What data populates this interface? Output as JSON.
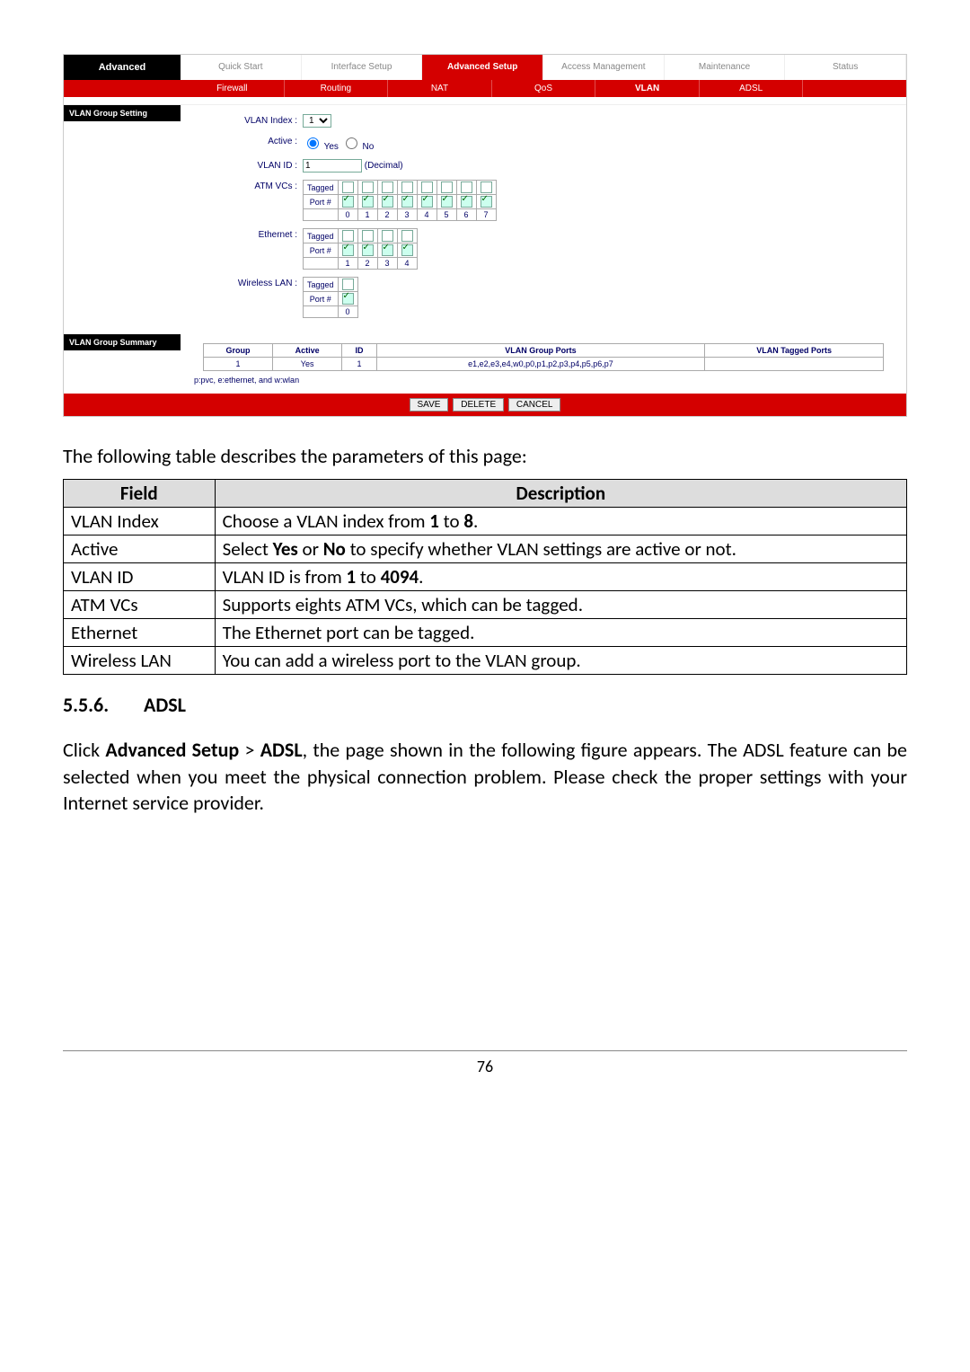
{
  "router": {
    "sideLabel": "Advanced",
    "tabs": [
      "Quick\nStart",
      "Interface\nSetup",
      "Advanced\nSetup",
      "Access\nManagement",
      "Maintenance",
      "Status"
    ],
    "activeTab": 2,
    "subtabs": [
      "Firewall",
      "Routing",
      "NAT",
      "QoS",
      "VLAN",
      "ADSL"
    ],
    "activeSubtab": 4,
    "section1": "VLAN Group Setting",
    "vlanIndexLabel": "VLAN Index :",
    "vlanIndexValue": "1",
    "activeLabel": "Active :",
    "yesLabel": "Yes",
    "noLabel": "No",
    "vlanIdLabel": "VLAN ID :",
    "vlanIdValue": "1",
    "decimal": "(Decimal)",
    "atmLabel": "ATM VCs :",
    "taggedLabel": "Tagged",
    "portLabel": "Port #",
    "atmPorts": [
      "0",
      "1",
      "2",
      "3",
      "4",
      "5",
      "6",
      "7"
    ],
    "ethLabel": "Ethernet :",
    "ethPorts": [
      "1",
      "2",
      "3",
      "4"
    ],
    "wlanLabel": "Wireless LAN :",
    "wlanPorts": [
      "0"
    ],
    "section2": "VLAN Group Summary",
    "summaryHeaders": [
      "Group",
      "Active",
      "ID",
      "VLAN Group Ports",
      "VLAN Tagged Ports"
    ],
    "summaryRow": [
      "1",
      "Yes",
      "1",
      "e1,e2,e3,e4,w0,p0,p1,p2,p3,p4,p5,p6,p7",
      ""
    ],
    "legend": "p:pvc, e:ethernet, and w:wlan",
    "buttons": [
      "SAVE",
      "DELETE",
      "CANCEL"
    ]
  },
  "doc": {
    "intro": "The following table describes the parameters of this page:",
    "colField": "Field",
    "colDesc": "Description",
    "rows": [
      {
        "field": "VLAN Index",
        "desc_pre": "Choose a VLAN index from ",
        "b1": "1",
        "mid": " to ",
        "b2": "8",
        "post": "."
      },
      {
        "field": "Active",
        "desc_pre": "Select ",
        "b1": "Yes",
        "mid": " or ",
        "b2": "No",
        "post": " to specify whether VLAN settings are active or not."
      },
      {
        "field": "VLAN ID",
        "desc_pre": "VLAN ID is from ",
        "b1": "1",
        "mid": " to ",
        "b2": "4094",
        "post": "."
      },
      {
        "field": "ATM VCs",
        "desc_pre": "Supports eights ATM VCs, which can be tagged.",
        "b1": "",
        "mid": "",
        "b2": "",
        "post": ""
      },
      {
        "field": "Ethernet",
        "desc_pre": "The Ethernet port can be tagged.",
        "b1": "",
        "mid": "",
        "b2": "",
        "post": ""
      },
      {
        "field": "Wireless LAN",
        "desc_pre": "You can add a wireless port to the VLAN group.",
        "b1": "",
        "mid": "",
        "b2": "",
        "post": ""
      }
    ],
    "headingNum": "5.5.6.",
    "headingTitle": "ADSL",
    "body_pre": "Click ",
    "body_b1": "Advanced Setup",
    "body_mid1": " > ",
    "body_b2": "ADSL",
    "body_post": ", the page shown in the following figure appears. The ADSL feature can be selected when you meet the physical connection problem. Please check the proper settings with your Internet service provider.",
    "pageNumber": "76"
  }
}
